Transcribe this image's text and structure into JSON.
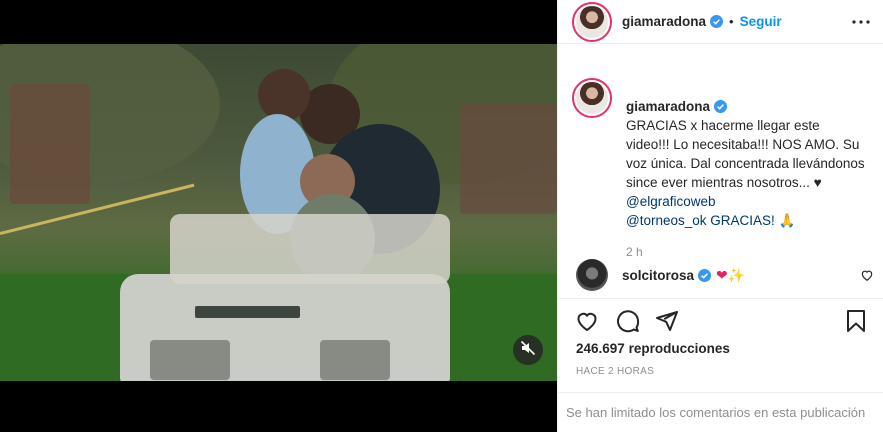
{
  "header": {
    "username": "giamaradona",
    "dot": "•",
    "follow_label": "Seguir"
  },
  "caption": {
    "username": "giamaradona",
    "text": "GRACIAS x hacerme llegar este video!!! Lo necesitaba!!! NOS AMO. Su voz única. Dal concentrada llevándonos since ever mientras nosotros... ♥",
    "mentions": [
      "@elgraficoweb",
      "@torneos_ok GRACIAS! 🙏"
    ],
    "time": "2 h"
  },
  "comment": {
    "username": "solcitorosa",
    "text": "❤✨"
  },
  "stats": {
    "views_count": "246.697",
    "views_label": "reproducciones",
    "date": "HACE 2 HORAS"
  },
  "footer": {
    "comments_limited": "Se han limitado los comentarios en esta publicación"
  },
  "icons": {
    "verified": "verified-badge-icon",
    "more": "more-options-icon",
    "like": "heart-icon",
    "comment": "comment-icon",
    "share": "share-icon",
    "save": "bookmark-icon",
    "mute": "speaker-muted-icon"
  },
  "colors": {
    "accent": "#0095f6",
    "verified": "#3897f0",
    "avatar_ring": "#e1306c",
    "muted_text": "#8e8e8e"
  }
}
